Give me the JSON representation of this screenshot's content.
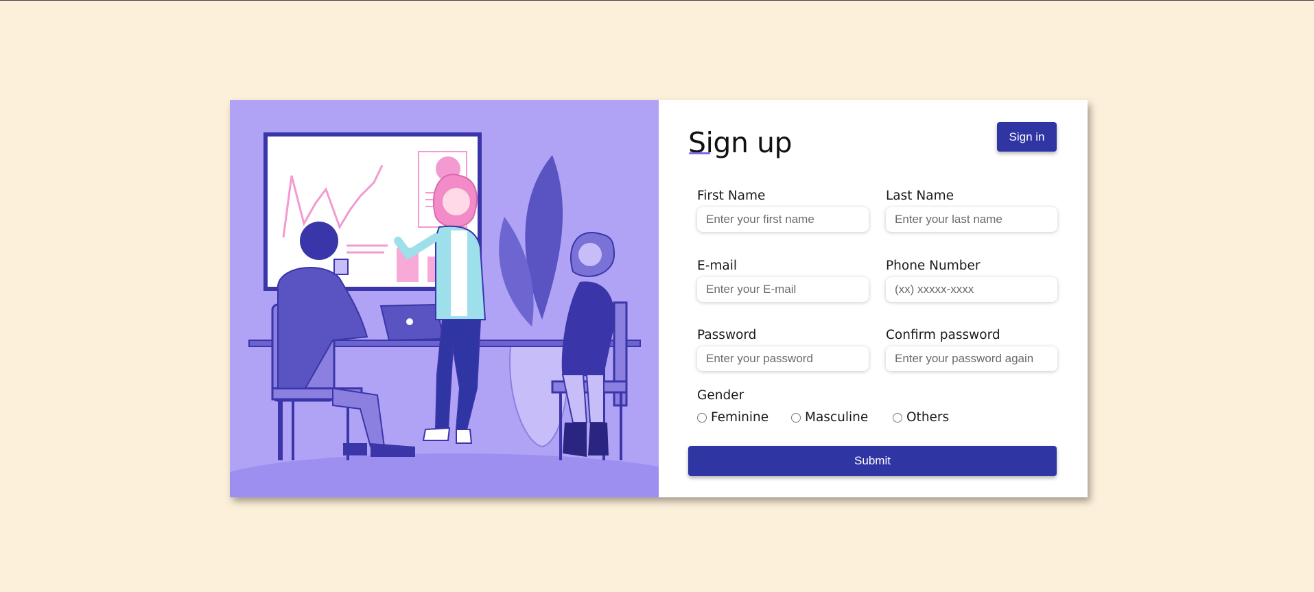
{
  "illustration": {
    "icon": "team-meeting-illustration"
  },
  "form": {
    "title": "Sign up",
    "signin_label": "Sign in",
    "fields": {
      "first_name": {
        "label": "First Name",
        "placeholder": "Enter your first name"
      },
      "last_name": {
        "label": "Last Name",
        "placeholder": "Enter your last name"
      },
      "email": {
        "label": "E-mail",
        "placeholder": "Enter your E-mail"
      },
      "phone": {
        "label": "Phone Number",
        "placeholder": "(xx) xxxxx-xxxx"
      },
      "password": {
        "label": "Password",
        "placeholder": "Enter your password"
      },
      "confirm_password": {
        "label": "Confirm password",
        "placeholder": "Enter your password again"
      }
    },
    "gender": {
      "label": "Gender",
      "options": [
        "Feminine",
        "Masculine",
        "Others"
      ]
    },
    "submit_label": "Submit"
  },
  "colors": {
    "page_background": "#fcf0da",
    "illustration_background": "#b0a3f5",
    "accent": "#3035a4",
    "title_underline": "#7a6af0"
  }
}
